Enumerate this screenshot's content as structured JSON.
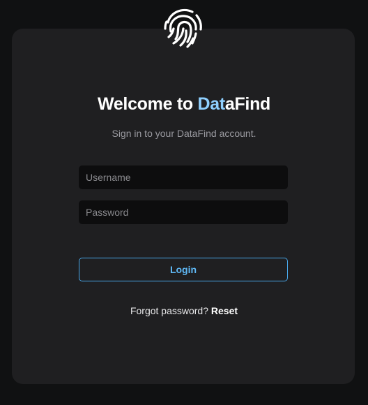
{
  "header": {
    "logo_icon": "fingerprint-icon"
  },
  "welcome": {
    "title_part1": "Welcome to ",
    "title_brand_a": "Dat",
    "title_brand_b": "aFind",
    "brand_color": "#8fd0ff",
    "subtitle": "Sign in to your DataFind account."
  },
  "form": {
    "username_placeholder": "Username",
    "username_value": "",
    "password_placeholder": "Password",
    "password_value": "",
    "login_label": "Login",
    "accent_color": "#48a6e8"
  },
  "footer": {
    "forgot_text": "Forgot password? ",
    "reset_label": "Reset"
  }
}
